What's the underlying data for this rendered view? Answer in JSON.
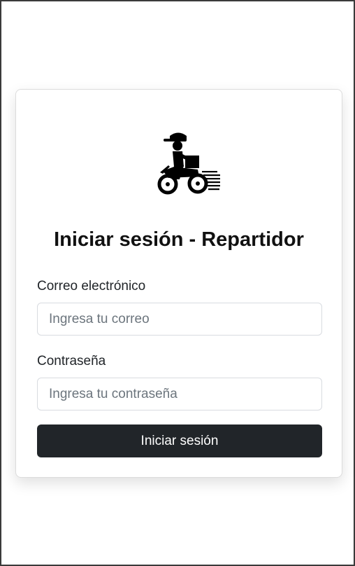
{
  "login": {
    "title": "Iniciar sesión - Repartidor",
    "logo_icon": "delivery-motorbike-icon",
    "email": {
      "label": "Correo electrónico",
      "placeholder": "Ingresa tu correo",
      "value": ""
    },
    "password": {
      "label": "Contraseña",
      "placeholder": "Ingresa tu contraseña",
      "value": ""
    },
    "submit_label": "Iniciar sesión"
  },
  "colors": {
    "button_bg": "#212529",
    "button_text": "#ffffff",
    "card_border": "#dcdcdc"
  }
}
